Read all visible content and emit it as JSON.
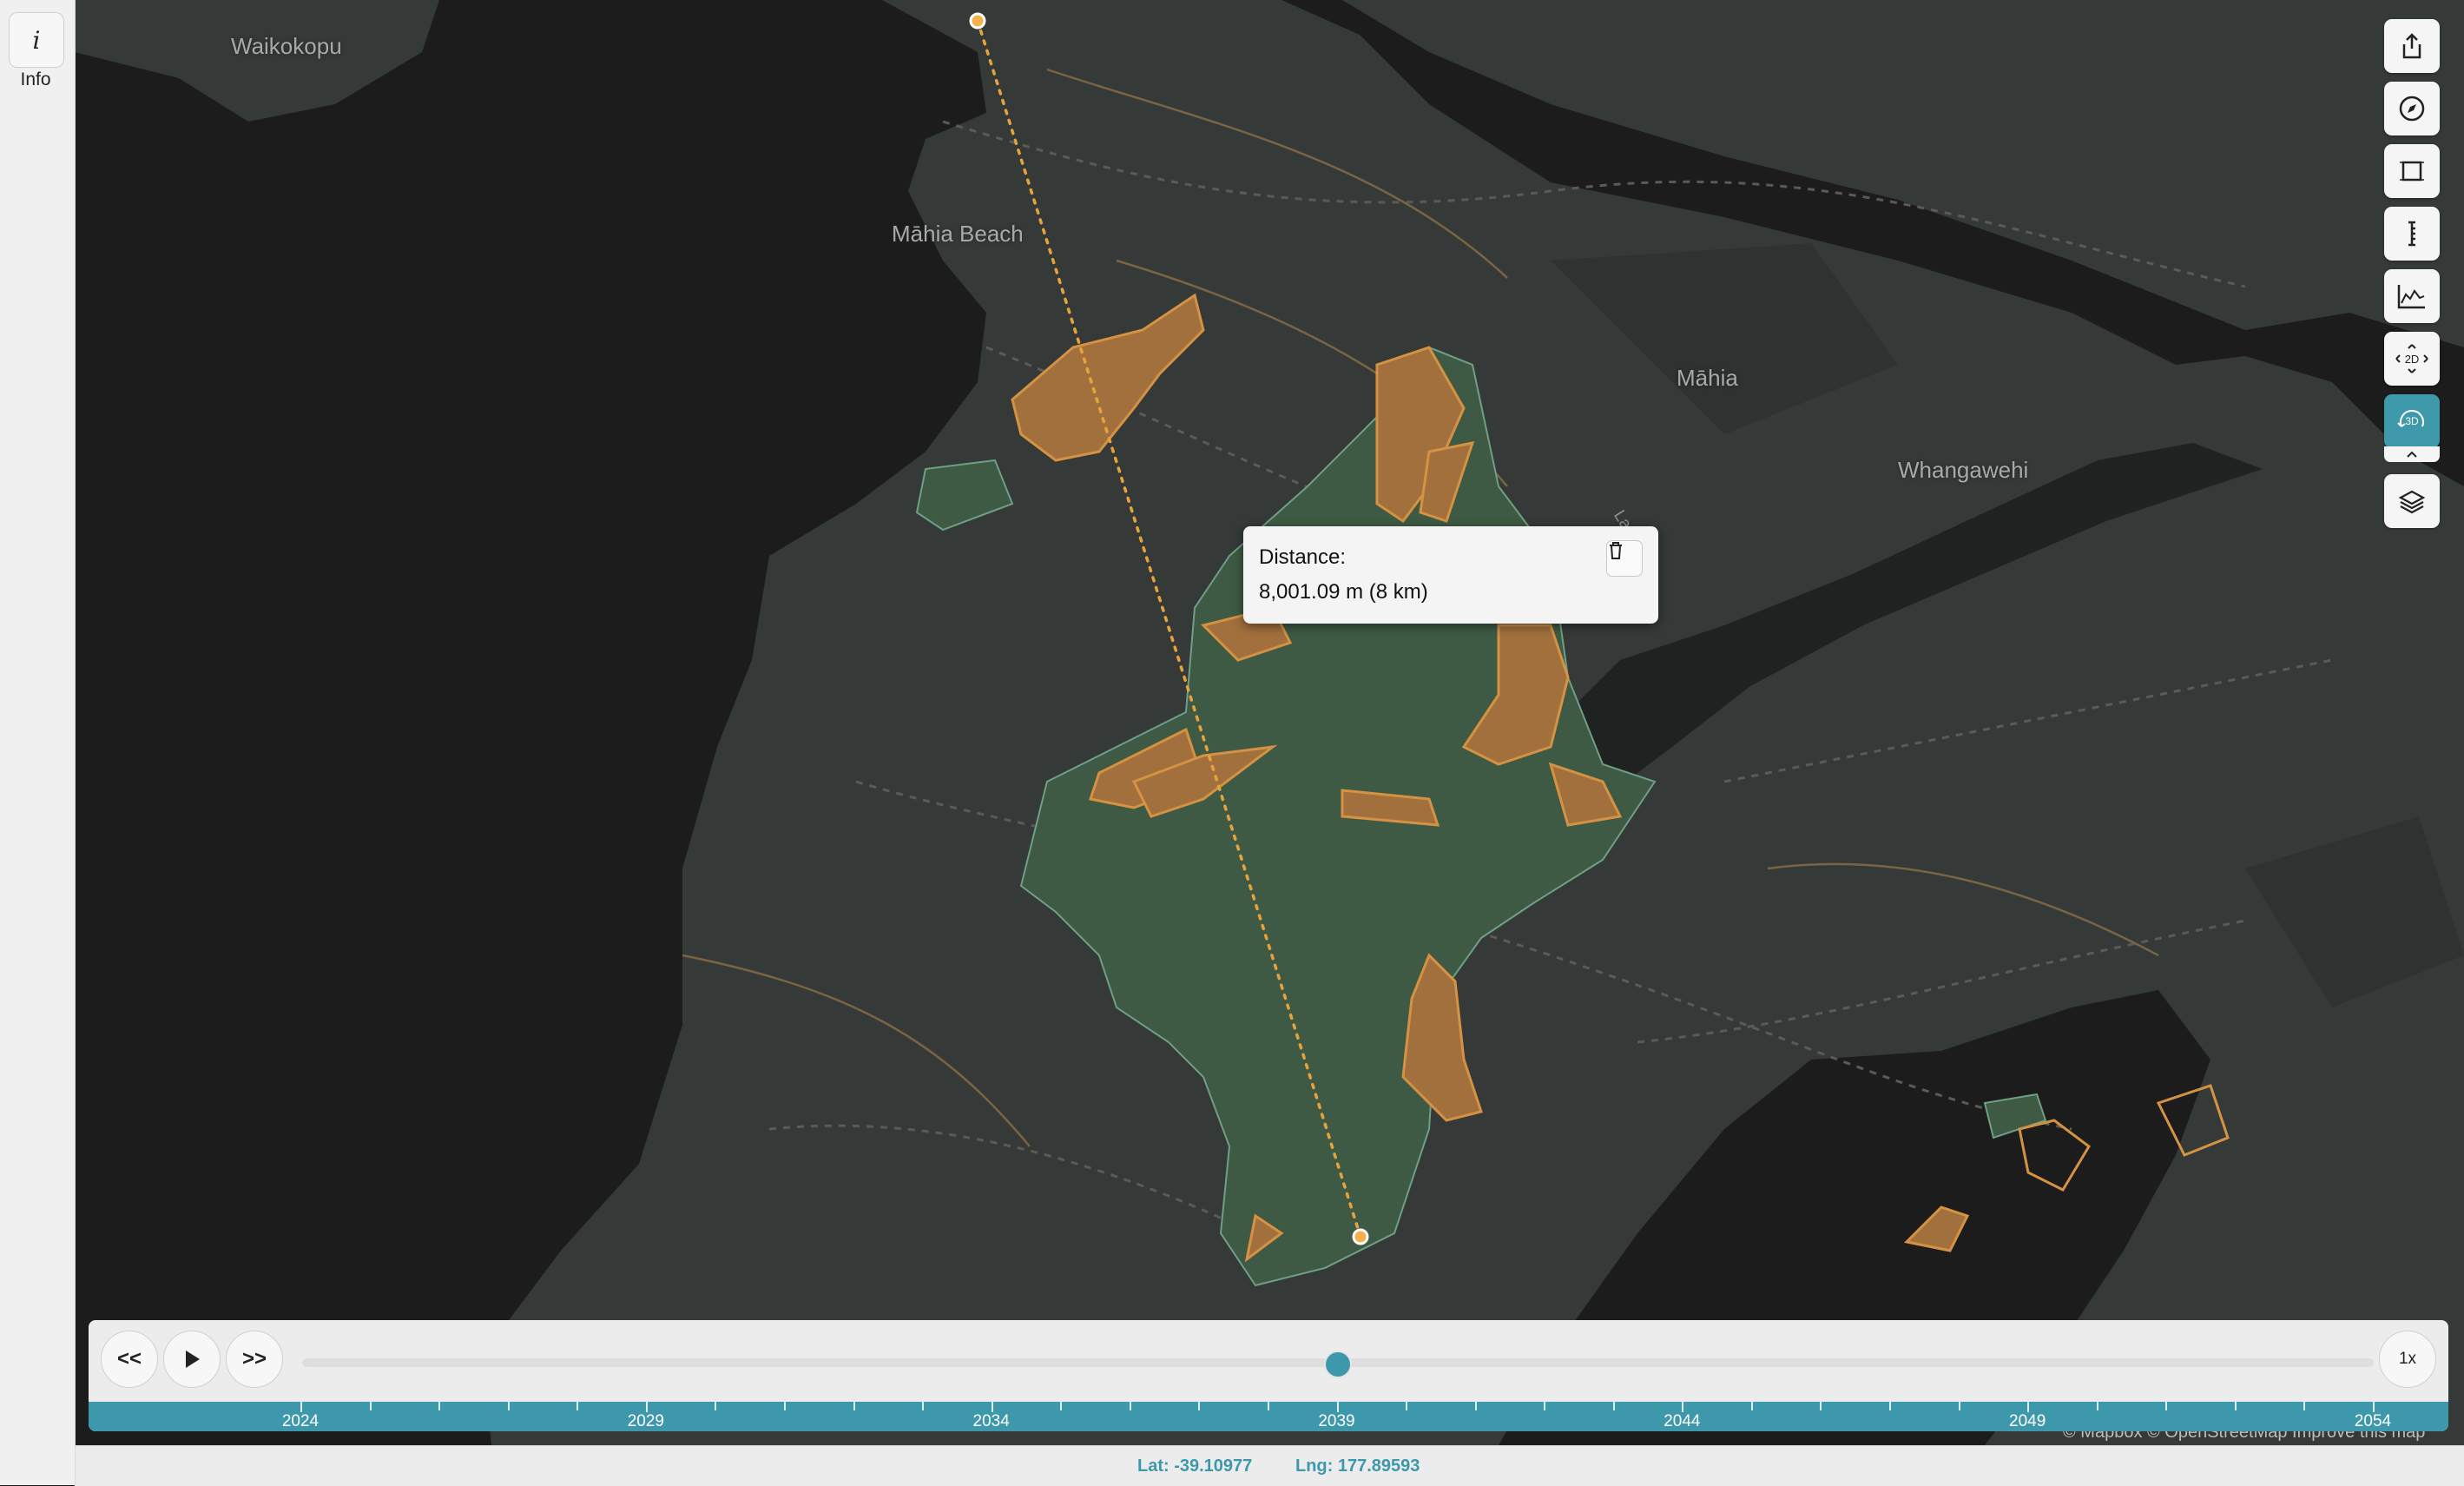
{
  "sidebar": {
    "info_icon": "i",
    "info_label": "Info"
  },
  "map": {
    "place_labels": {
      "waikokopu": "Waikokopu",
      "mahia_beach": "Māhia Beach",
      "mahia": "Māhia",
      "whangawehi": "Whangawehi",
      "lane_rd": "Lane Rd"
    },
    "colors": {
      "water": "#1c1c1c",
      "land": "#353a39",
      "forest": "#3e5a44",
      "highlight": "#c88a3c",
      "measure_line": "#e7a33b"
    }
  },
  "measurement": {
    "label": "Distance:",
    "value": "8,001.09 m (8 km)",
    "delete_icon": "trash-icon"
  },
  "controls": {
    "buttons": [
      {
        "name": "share-button",
        "icon": "share-icon"
      },
      {
        "name": "compass-button",
        "icon": "compass-icon"
      },
      {
        "name": "area-measure-button",
        "icon": "area-icon"
      },
      {
        "name": "ruler-button",
        "icon": "ruler-icon"
      },
      {
        "name": "elevation-profile-button",
        "icon": "elevation-icon"
      },
      {
        "name": "view-2d-button",
        "icon": "2d-icon",
        "label": "2D"
      },
      {
        "name": "view-3d-button",
        "icon": "3d-icon",
        "label": "3D",
        "active": true
      },
      {
        "name": "layers-button",
        "icon": "layers-icon"
      }
    ]
  },
  "timeline": {
    "prev_label": "<<",
    "next_label": ">>",
    "play_icon": "play-icon",
    "speed_label": "1x",
    "start_year": 2024,
    "end_year": 2054,
    "current_year": 2039,
    "year_labels": [
      "2024",
      "2029",
      "2034",
      "2039",
      "2044",
      "2049",
      "2054"
    ]
  },
  "status": {
    "lat": "Lat: -39.10977",
    "lng": "Lng: 177.89593"
  },
  "attribution": "© Mapbox © OpenStreetMap Improve this map"
}
